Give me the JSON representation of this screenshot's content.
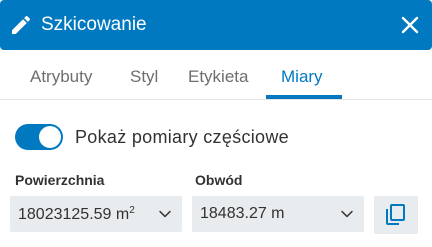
{
  "header": {
    "title": "Szkicowanie",
    "icon": "pencil-icon",
    "close_icon": "close-icon",
    "accent_color": "#0079c1"
  },
  "tabs": [
    {
      "label": "Atrybuty",
      "active": false
    },
    {
      "label": "Styl",
      "active": false
    },
    {
      "label": "Etykieta",
      "active": false
    },
    {
      "label": "Miary",
      "active": true
    }
  ],
  "measure": {
    "toggle_label": "Pokaż pomiary częściowe",
    "toggle_on": true,
    "area": {
      "label": "Powierzchnia",
      "value": "18023125.59 m",
      "unit_sup": "2"
    },
    "perimeter": {
      "label": "Obwód",
      "value": "18483.27 m"
    },
    "copy_icon": "copy-icon"
  }
}
